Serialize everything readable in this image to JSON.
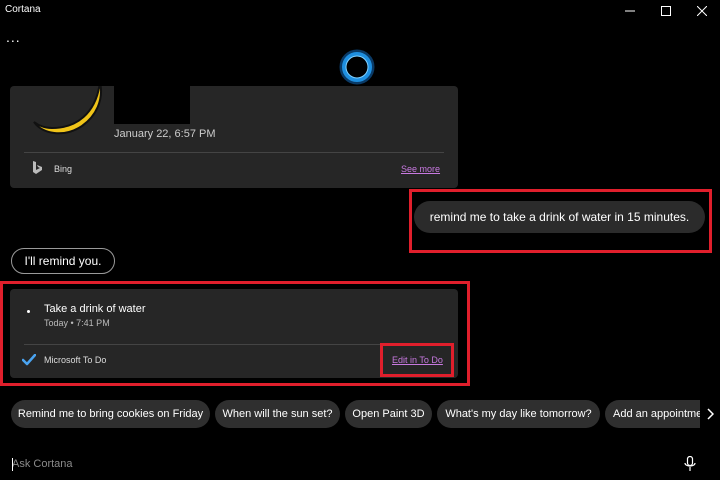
{
  "window": {
    "title": "Cortana"
  },
  "header": {
    "more_label": "..."
  },
  "weather_card": {
    "date": "January 22, 6:57 PM",
    "source": "Bing",
    "see_more": "See more"
  },
  "conversation": {
    "user_message": "remind me to take a drink of water in 15 minutes.",
    "cortana_reply": "I'll remind you."
  },
  "reminder_card": {
    "title": "Take a drink of water",
    "time": "Today • 7:41 PM",
    "app": "Microsoft To Do",
    "edit_link": "Edit in To Do"
  },
  "suggestions": [
    "Remind me to bring cookies on Friday",
    "When will the sun set?",
    "Open Paint 3D",
    "What's my day like tomorrow?",
    "Add an appointme"
  ],
  "input": {
    "placeholder": "Ask Cortana",
    "value": ""
  },
  "colors": {
    "highlight": "#e01f2c",
    "link": "#c879e0",
    "cortana_ring": "#1e8fe0"
  },
  "icons": [
    "minimize-icon",
    "maximize-icon",
    "close-icon",
    "cortana-ring-icon",
    "moon-icon",
    "bing-icon",
    "checkmark-icon",
    "chevron-right-icon",
    "microphone-icon"
  ]
}
